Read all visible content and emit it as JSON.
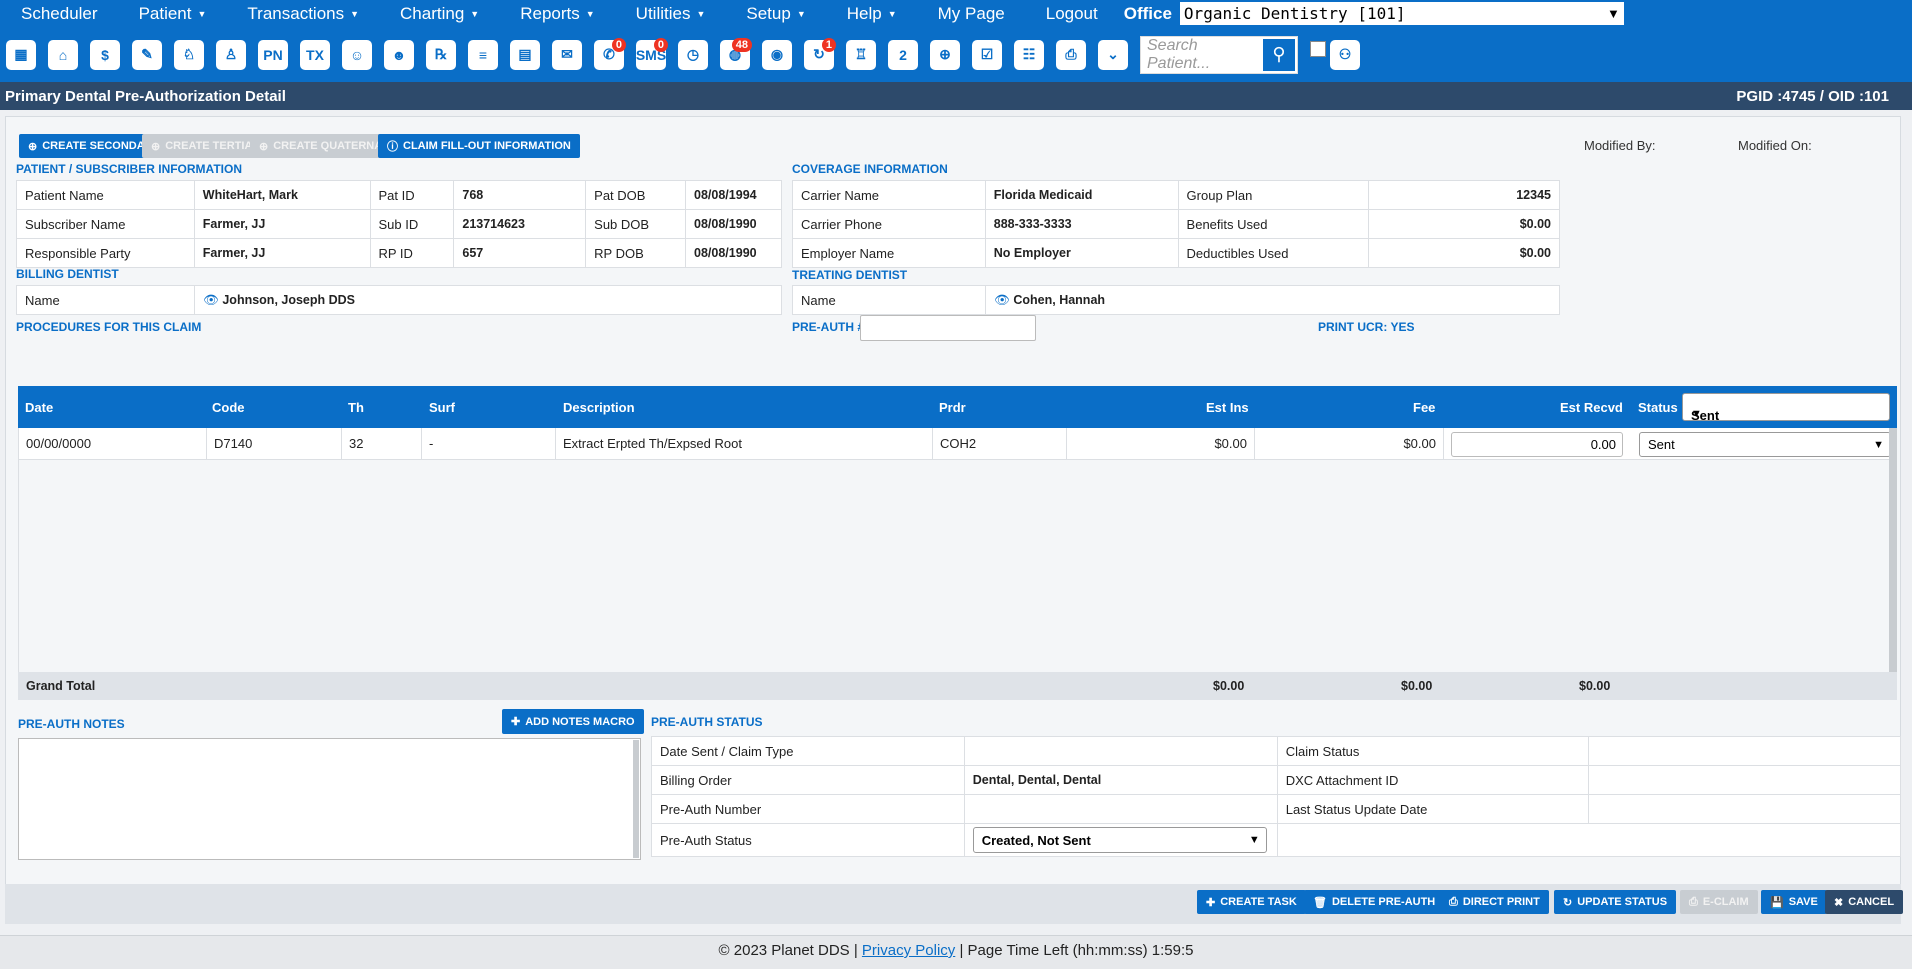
{
  "nav": {
    "items": [
      {
        "label": "Scheduler",
        "caret": false
      },
      {
        "label": "Patient",
        "caret": true
      },
      {
        "label": "Transactions",
        "caret": true
      },
      {
        "label": "Charting",
        "caret": true
      },
      {
        "label": "Reports",
        "caret": true
      },
      {
        "label": "Utilities",
        "caret": true
      },
      {
        "label": "Setup",
        "caret": true
      },
      {
        "label": "Help",
        "caret": true
      },
      {
        "label": "My Page",
        "caret": false
      },
      {
        "label": "Logout",
        "caret": false
      }
    ],
    "office_label": "Office",
    "office_value": "Organic Dentistry [101]"
  },
  "iconbar": {
    "icons": [
      {
        "name": "calendar-icon",
        "glyph": "▦"
      },
      {
        "name": "home-icon",
        "glyph": "⌂"
      },
      {
        "name": "dollar-icon",
        "glyph": "$"
      },
      {
        "name": "edit-icon",
        "glyph": "✎"
      },
      {
        "name": "tooth-chart-icon",
        "glyph": "♘"
      },
      {
        "name": "tooth-icon",
        "glyph": "♙"
      },
      {
        "name": "pn-icon",
        "glyph": "PN"
      },
      {
        "name": "tx-icon",
        "glyph": "TX"
      },
      {
        "name": "add-patient-icon",
        "glyph": "☺"
      },
      {
        "name": "add-user-icon",
        "glyph": "☻"
      },
      {
        "name": "rx-icon",
        "glyph": "℞"
      },
      {
        "name": "message-icon",
        "glyph": "≡"
      },
      {
        "name": "document-icon",
        "glyph": "▤"
      },
      {
        "name": "mail-icon",
        "glyph": "✉"
      },
      {
        "name": "chat-icon",
        "glyph": "✆",
        "badge": "0"
      },
      {
        "name": "sms-icon",
        "glyph": "SMS",
        "badge": "0"
      },
      {
        "name": "clock-icon",
        "glyph": "◷"
      },
      {
        "name": "globe-user-icon",
        "glyph": "◍",
        "badge": "48"
      },
      {
        "name": "support-icon",
        "glyph": "◉"
      },
      {
        "name": "refresh-user-icon",
        "glyph": "↻",
        "badge": "1"
      },
      {
        "name": "tooth-square-icon",
        "glyph": "♖"
      },
      {
        "name": "tooth-two-icon",
        "glyph": "2"
      },
      {
        "name": "globe-icon",
        "glyph": "⊕"
      },
      {
        "name": "checklist-icon",
        "glyph": "☑"
      },
      {
        "name": "family-icon",
        "glyph": "☷"
      },
      {
        "name": "print-icon",
        "glyph": "⎙"
      },
      {
        "name": "expand-icon",
        "glyph": "⌄"
      }
    ],
    "search_placeholder": "Search Patient..."
  },
  "titlebar": {
    "title": "Primary Dental Pre-Authorization Detail",
    "ids": "PGID :4745  /  OID :101"
  },
  "actions": {
    "create_secondary": "CREATE SECONDARY",
    "create_tertiary": "CREATE TERTIARY",
    "create_quaternary": "CREATE QUATERNARY",
    "claim_fillout": "CLAIM FILL-OUT INFORMATION"
  },
  "meta": {
    "modified_by": "Modified By:",
    "modified_on": "Modified On:"
  },
  "patient_section": {
    "heading": "PATIENT / SUBSCRIBER INFORMATION",
    "rows": [
      [
        "Patient Name",
        "WhiteHart, Mark",
        "Pat ID",
        "768",
        "Pat DOB",
        "08/08/1994"
      ],
      [
        "Subscriber Name",
        "Farmer, JJ",
        "Sub ID",
        "213714623",
        "Sub DOB",
        "08/08/1990"
      ],
      [
        "Responsible Party",
        "Farmer, JJ",
        "RP ID",
        "657",
        "RP DOB",
        "08/08/1990"
      ]
    ]
  },
  "coverage_section": {
    "heading": "COVERAGE INFORMATION",
    "rows": [
      [
        "Carrier Name",
        "Florida Medicaid",
        "Group Plan",
        "12345"
      ],
      [
        "Carrier Phone",
        "888-333-3333",
        "Benefits Used",
        "$0.00"
      ],
      [
        "Employer Name",
        "No Employer",
        "Deductibles Used",
        "$0.00"
      ]
    ]
  },
  "billing_dentist": {
    "heading": "BILLING DENTIST",
    "label": "Name",
    "value": "Johnson, Joseph DDS"
  },
  "treating_dentist": {
    "heading": "TREATING DENTIST",
    "label": "Name",
    "value": "Cohen, Hannah"
  },
  "procedures": {
    "heading": "PROCEDURES FOR THIS CLAIM",
    "preauth_label": "PRE-AUTH #",
    "print_ucr": "PRINT UCR: YES",
    "columns": {
      "date": "Date",
      "code": "Code",
      "th": "Th",
      "surf": "Surf",
      "description": "Description",
      "prdr": "Prdr",
      "est_ins": "Est Ins",
      "fee": "Fee",
      "est_recvd": "Est Recvd",
      "status": "Status"
    },
    "header_status_value": "Sent",
    "rows": [
      {
        "date": "00/00/0000",
        "code": "D7140",
        "th": "32",
        "surf": "-",
        "description": "Extract Erpted Th/Expsed Root",
        "prdr": "COH2",
        "est_ins": "$0.00",
        "fee": "$0.00",
        "est_recvd": "0.00",
        "status": "Sent"
      }
    ],
    "grand_total_label": "Grand Total",
    "grand_est_ins": "$0.00",
    "grand_fee": "$0.00",
    "grand_est_recvd": "$0.00"
  },
  "notes": {
    "heading": "PRE-AUTH NOTES",
    "add_macro": "ADD NOTES MACRO"
  },
  "status_section": {
    "heading": "PRE-AUTH STATUS",
    "rows": [
      [
        "Date Sent / Claim Type",
        "",
        "Claim Status",
        ""
      ],
      [
        "Billing Order",
        "Dental, Dental, Dental",
        "DXC Attachment ID",
        ""
      ],
      [
        "Pre-Auth Number",
        "",
        "Last Status Update Date",
        ""
      ]
    ],
    "preauth_status_label": "Pre-Auth Status",
    "preauth_status_value": "Created, Not Sent"
  },
  "footer_buttons": {
    "create_task": "CREATE TASK",
    "delete_preauth": "DELETE PRE-AUTH",
    "direct_print": "DIRECT PRINT",
    "update_status": "UPDATE STATUS",
    "eclaim": "E-CLAIM",
    "save": "SAVE",
    "cancel": "CANCEL"
  },
  "copyright": {
    "text": "© 2023 Planet DDS |",
    "privacy": "Privacy Policy",
    "timer": "|  Page Time Left (hh:mm:ss) 1:59:5"
  }
}
